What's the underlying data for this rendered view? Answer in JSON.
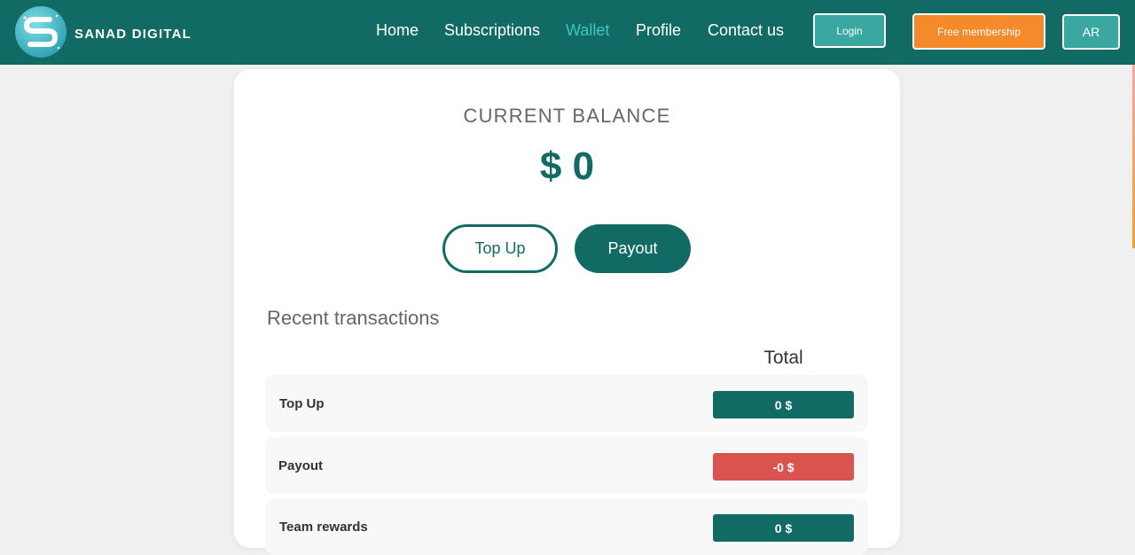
{
  "brand": {
    "name": "SANAD DIGITAL"
  },
  "nav": {
    "links": [
      {
        "label": "Home",
        "active": false
      },
      {
        "label": "Subscriptions",
        "active": false
      },
      {
        "label": "Wallet",
        "active": true
      },
      {
        "label": "Profile",
        "active": false
      },
      {
        "label": "Contact us",
        "active": false
      }
    ],
    "login_label": "Login",
    "free_membership_label": "Free membership",
    "language_label": "AR"
  },
  "wallet": {
    "balance_title": "CURRENT BALANCE",
    "balance_amount": "$ 0",
    "topup_label": "Top Up",
    "payout_label": "Payout"
  },
  "transactions": {
    "title": "Recent transactions",
    "total_header": "Total",
    "rows": [
      {
        "label": "Top Up",
        "amount": "0 $",
        "kind": "positive"
      },
      {
        "label": "Payout",
        "amount": "-0 $",
        "kind": "negative"
      },
      {
        "label": "Team rewards",
        "amount": "0 $",
        "kind": "positive"
      }
    ]
  },
  "colors": {
    "primary": "#126a64",
    "accent": "#3ec6c0",
    "orange": "#f58a2a",
    "negative": "#d9534f",
    "background": "#f0f0f0"
  }
}
